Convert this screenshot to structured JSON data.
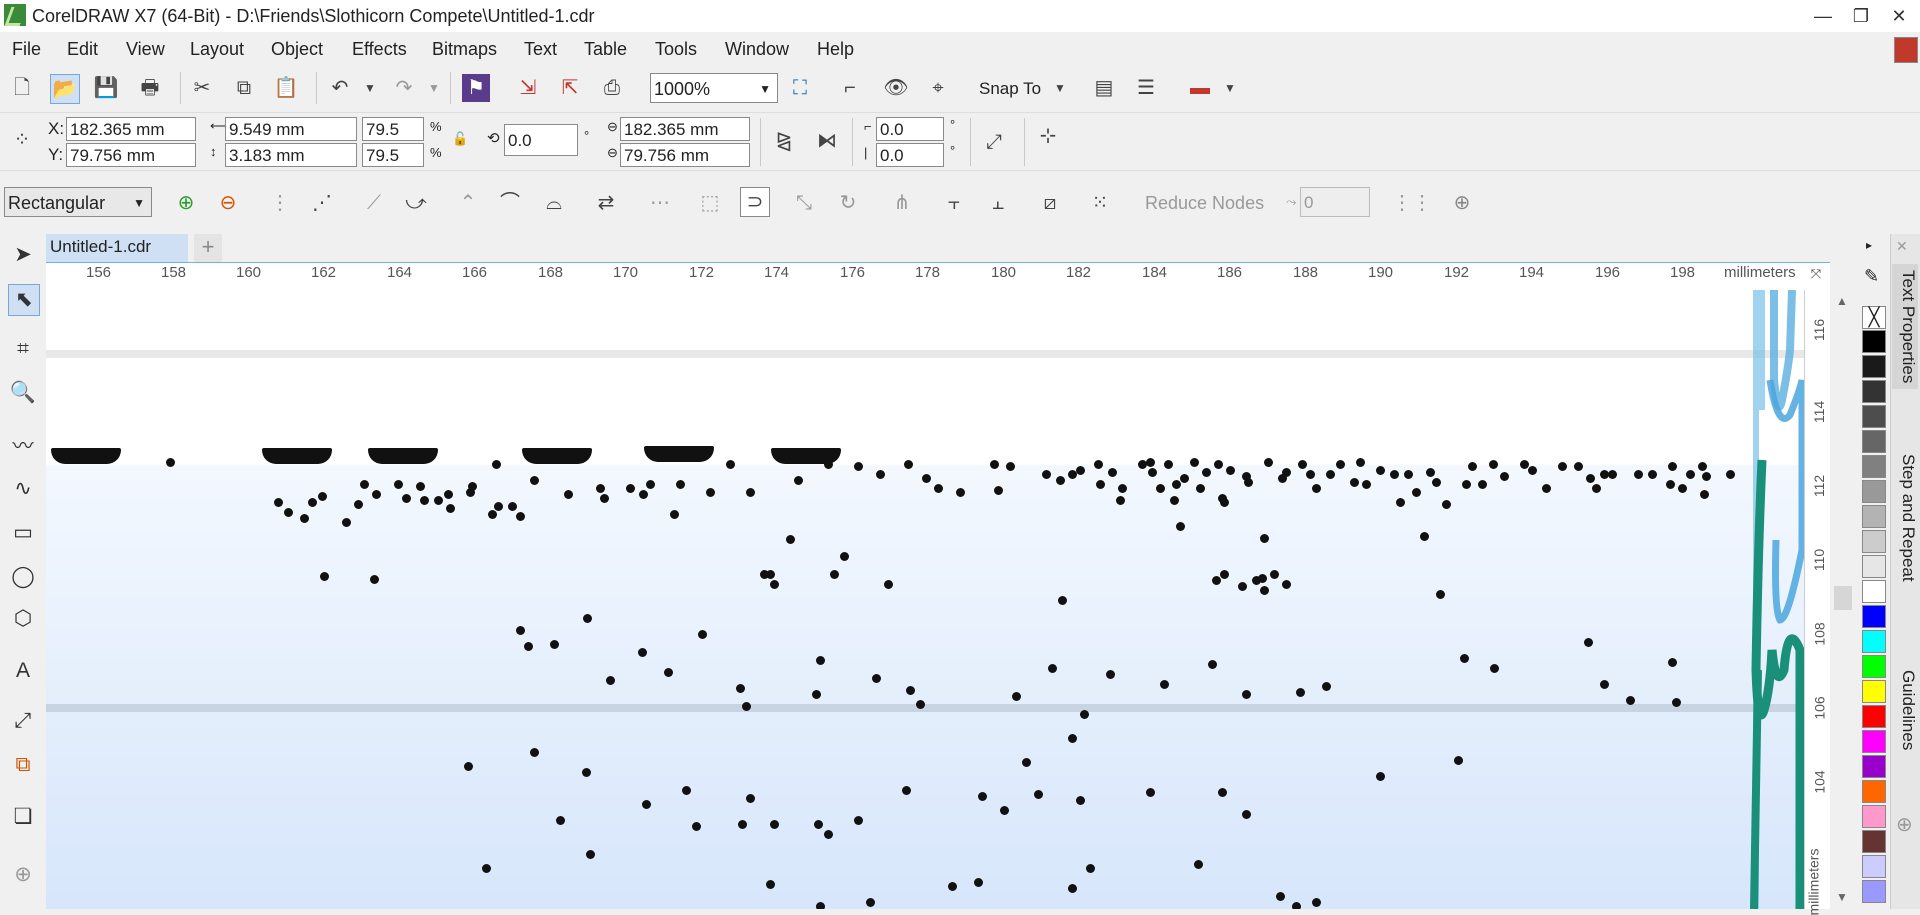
{
  "window": {
    "title": "CorelDRAW X7 (64-Bit) - D:\\Friends\\Slothicorn Compete\\Untitled-1.cdr",
    "controls": [
      "—",
      "❐",
      "✕"
    ]
  },
  "menu": [
    "File",
    "Edit",
    "View",
    "Layout",
    "Object",
    "Effects",
    "Bitmaps",
    "Text",
    "Table",
    "Tools",
    "Window",
    "Help"
  ],
  "standard_toolbar": {
    "zoom_value": "1000%",
    "snap_to_label": "Snap To"
  },
  "property_bar": {
    "x_label": "X:",
    "y_label": "Y:",
    "x_value": "182.365 mm",
    "y_value": "79.756 mm",
    "width_value": "9.549 mm",
    "height_value": "3.183 mm",
    "scale_x": "79.5",
    "scale_y": "79.5",
    "percent": "%",
    "rotation": "0.0",
    "degree": "°",
    "center_x": "182.365 mm",
    "center_y": "79.756 mm",
    "skew_h": "0.0",
    "skew_v": "0.0"
  },
  "node_bar": {
    "selection_mode": "Rectangular",
    "reduce_nodes_label": "Reduce Nodes",
    "smoothing_value": "0"
  },
  "document_tab": {
    "label": "Untitled-1.cdr",
    "add_label": "+"
  },
  "ruler": {
    "units": "millimeters",
    "h_ticks": [
      "156",
      "158",
      "160",
      "162",
      "164",
      "166",
      "168",
      "170",
      "172",
      "174",
      "176",
      "178",
      "180",
      "182",
      "184",
      "186",
      "188",
      "190",
      "192",
      "194",
      "196",
      "198"
    ],
    "v_ticks": [
      "116",
      "114",
      "112",
      "110",
      "108",
      "106",
      "104"
    ],
    "v_units": "millimeters"
  },
  "dockers": [
    "Text Properties",
    "Step and Repeat",
    "Guidelines"
  ],
  "palette_colors": [
    "#000000",
    "#1a1a1a",
    "#333333",
    "#4d4d4d",
    "#666666",
    "#808080",
    "#999999",
    "#b3b3b3",
    "#cccccc",
    "#e6e6e6",
    "#ffffff",
    "#0000ff",
    "#00ffff",
    "#00ff00",
    "#ffff00",
    "#ff0000",
    "#ff00ff",
    "#9900cc",
    "#ff6600",
    "#ff99cc",
    "#663333",
    "#ccccff",
    "#9999ff"
  ],
  "icons": {
    "new": "new-document-icon",
    "open": "open-icon",
    "save": "save-icon",
    "print": "print-icon",
    "cut": "cut-icon",
    "copy": "copy-icon",
    "paste": "paste-icon",
    "undo": "undo-icon",
    "redo": "redo-icon"
  }
}
